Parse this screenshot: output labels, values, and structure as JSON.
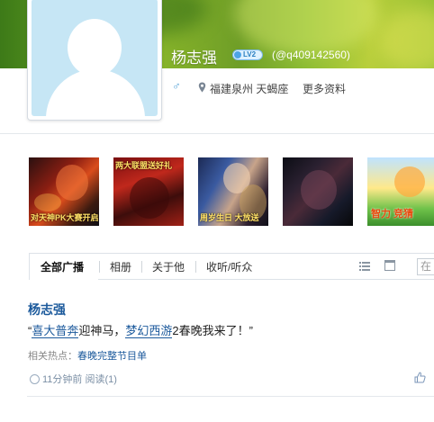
{
  "profile": {
    "name": "杨志强",
    "level_badge": "LV2",
    "qq_id": "(@q409142560)",
    "gender_icon": "male-icon",
    "location": "福建泉州 天蝎座",
    "more_info": "更多资料"
  },
  "thumbnails": [
    {
      "name": "game-thumb-1",
      "caption": "对天神PK大赛开启"
    },
    {
      "name": "game-thumb-2",
      "caption": "两大联盟送好礼"
    },
    {
      "name": "game-thumb-3",
      "caption": "周岁生日 大放送"
    },
    {
      "name": "game-thumb-4",
      "caption": ""
    },
    {
      "name": "game-thumb-5",
      "caption": "智力 竞猜"
    }
  ],
  "tabs": {
    "items": [
      "全部广播",
      "相册",
      "关于他",
      "收听/听众"
    ],
    "active": "全部广播",
    "search_value": "在"
  },
  "post": {
    "author": "杨志强",
    "quote_open": "“",
    "topic1": "喜大普奔",
    "text1": "迎神马，",
    "topic2": "梦幻西游",
    "text2": "2春晚我来了！",
    "quote_close": "”",
    "related_label": "相关热点：",
    "related_link": "春晚完整节目单",
    "time": "11分钟前",
    "reads": "阅读(1)"
  },
  "colors": {
    "link": "#1c5a9c",
    "banner_green": "#6f9e27"
  }
}
